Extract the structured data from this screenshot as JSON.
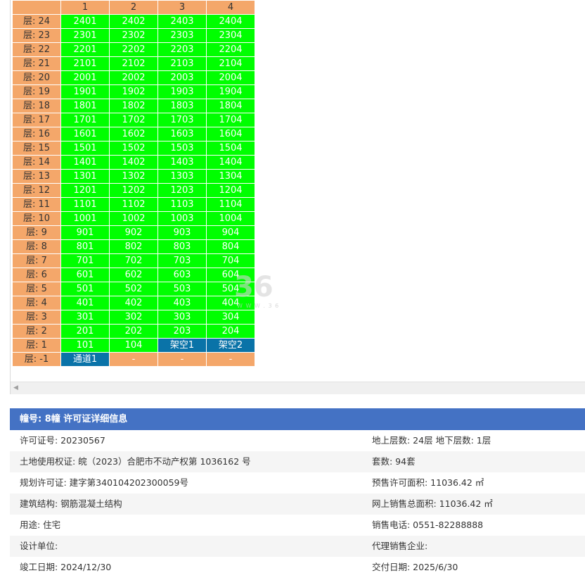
{
  "grid": {
    "columns": [
      "",
      "1",
      "2",
      "3",
      "4"
    ],
    "rows": [
      {
        "floor": "层: 24",
        "units": [
          "2401",
          "2402",
          "2403",
          "2404"
        ]
      },
      {
        "floor": "层: 23",
        "units": [
          "2301",
          "2302",
          "2303",
          "2304"
        ]
      },
      {
        "floor": "层: 22",
        "units": [
          "2201",
          "2202",
          "2203",
          "2204"
        ]
      },
      {
        "floor": "层: 21",
        "units": [
          "2101",
          "2102",
          "2103",
          "2104"
        ]
      },
      {
        "floor": "层: 20",
        "units": [
          "2001",
          "2002",
          "2003",
          "2004"
        ]
      },
      {
        "floor": "层: 19",
        "units": [
          "1901",
          "1902",
          "1903",
          "1904"
        ]
      },
      {
        "floor": "层: 18",
        "units": [
          "1801",
          "1802",
          "1803",
          "1804"
        ]
      },
      {
        "floor": "层: 17",
        "units": [
          "1701",
          "1702",
          "1703",
          "1704"
        ]
      },
      {
        "floor": "层: 16",
        "units": [
          "1601",
          "1602",
          "1603",
          "1604"
        ]
      },
      {
        "floor": "层: 15",
        "units": [
          "1501",
          "1502",
          "1503",
          "1504"
        ]
      },
      {
        "floor": "层: 14",
        "units": [
          "1401",
          "1402",
          "1403",
          "1404"
        ]
      },
      {
        "floor": "层: 13",
        "units": [
          "1301",
          "1302",
          "1303",
          "1304"
        ]
      },
      {
        "floor": "层: 12",
        "units": [
          "1201",
          "1202",
          "1203",
          "1204"
        ]
      },
      {
        "floor": "层: 11",
        "units": [
          "1101",
          "1102",
          "1103",
          "1104"
        ]
      },
      {
        "floor": "层: 10",
        "units": [
          "1001",
          "1002",
          "1003",
          "1004"
        ]
      },
      {
        "floor": "层: 9",
        "units": [
          "901",
          "902",
          "903",
          "904"
        ]
      },
      {
        "floor": "层: 8",
        "units": [
          "801",
          "802",
          "803",
          "804"
        ]
      },
      {
        "floor": "层: 7",
        "units": [
          "701",
          "702",
          "703",
          "704"
        ]
      },
      {
        "floor": "层: 6",
        "units": [
          "601",
          "602",
          "603",
          "604"
        ]
      },
      {
        "floor": "层: 5",
        "units": [
          "501",
          "502",
          "503",
          "504"
        ]
      },
      {
        "floor": "层: 4",
        "units": [
          "401",
          "402",
          "403",
          "404"
        ]
      },
      {
        "floor": "层: 3",
        "units": [
          "301",
          "302",
          "303",
          "304"
        ]
      },
      {
        "floor": "层: 2",
        "units": [
          "201",
          "202",
          "203",
          "204"
        ]
      },
      {
        "floor": "层: 1",
        "units": [
          "101",
          "104",
          "架空1",
          "架空2"
        ],
        "special": [
          false,
          false,
          true,
          true
        ]
      },
      {
        "floor": "层: -1",
        "units": [
          "通道1",
          "-",
          "-",
          "-"
        ],
        "special": [
          true,
          false,
          false,
          false
        ],
        "empty": [
          false,
          true,
          true,
          true
        ]
      }
    ],
    "colors": {
      "available": "#00ff00",
      "label": "#f4a76a",
      "special": "#0a73a8"
    }
  },
  "watermark": {
    "main": "36",
    "sub": "W W W . 3 6"
  },
  "info": {
    "title": "幢号: 8幢 许可证详细信息",
    "rows": [
      {
        "left": "许可证号: 20230567",
        "right": "地上层数: 24层  地下层数: 1层"
      },
      {
        "left": "土地使用权证: 皖（2023）合肥市不动产权第 1036162 号",
        "right": "套数: 94套"
      },
      {
        "left": "规划许可证: 建字第340104202300059号",
        "right": "预售许可面积: 11036.42 ㎡"
      },
      {
        "left": "建筑结构: 钢筋混凝土结构",
        "right": "网上销售总面积: 11036.42 ㎡"
      },
      {
        "left": "用途: 住宅",
        "right": "销售电话: 0551-82288888"
      },
      {
        "left": "设计单位:",
        "right": "代理销售企业:"
      },
      {
        "left": "竣工日期: 2024/12/30",
        "right": "交付日期: 2025/6/30"
      }
    ],
    "header_color": "#4472c4"
  }
}
